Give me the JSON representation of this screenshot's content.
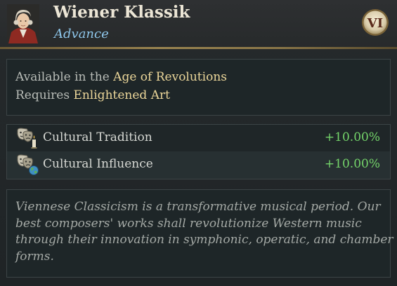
{
  "header": {
    "title": "Wiener Klassik",
    "subtitle": "Advance",
    "era_badge": "VI",
    "portrait_icon": "composer-portrait"
  },
  "requirements": {
    "available_prefix": "Available in the",
    "available_value": "Age of Revolutions",
    "requires_prefix": "Requires",
    "requires_value": "Enlightened Art"
  },
  "modifiers": [
    {
      "icon": "theater-masks-candle-icon",
      "label": "Cultural Tradition",
      "value": "+10.00%"
    },
    {
      "icon": "theater-masks-globe-icon",
      "label": "Cultural Influence",
      "value": "+10.00%"
    }
  ],
  "description": {
    "lines": [
      "Viennese Classicism is a transformative musical period. Our",
      "best composers' works shall revolutionize Western music",
      "through their innovation in symphonic, operatic, and chamber",
      "forms."
    ]
  },
  "colors": {
    "title": "#ece6d6",
    "subtitle": "#8ec6ea",
    "highlight": "#ecd79a",
    "positive": "#74d46a",
    "divider_gold": "#9a8450"
  }
}
